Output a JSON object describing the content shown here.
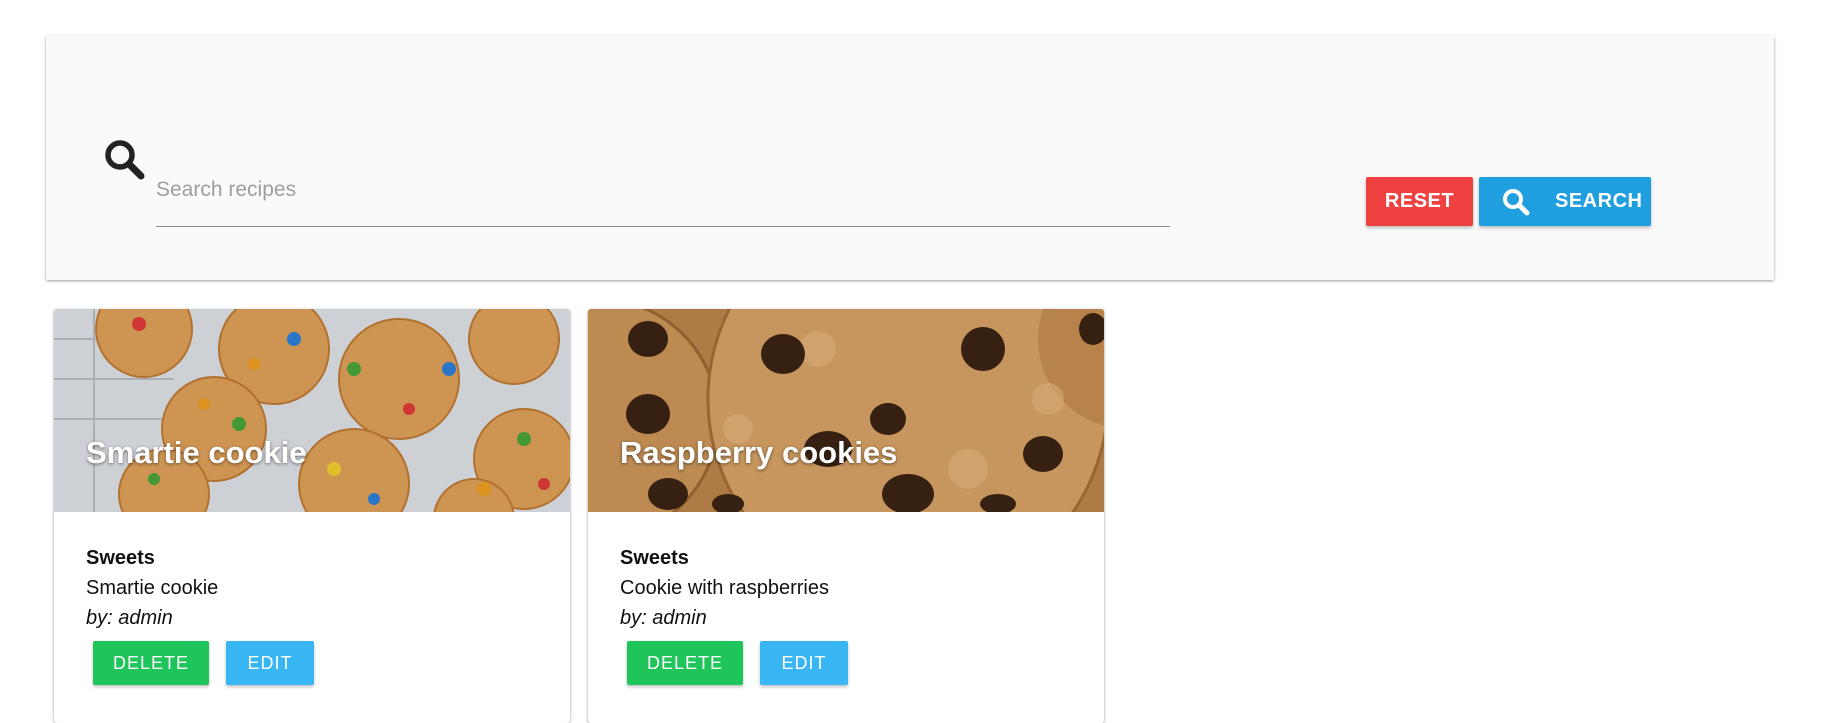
{
  "search": {
    "placeholder": "Search recipes",
    "value": "",
    "icon": "search-icon",
    "reset_label": "RESET",
    "search_label": "SEARCH"
  },
  "colors": {
    "reset": "#f04141",
    "search": "#1f9ee0",
    "delete": "#1fc45a",
    "edit": "#38b6f4"
  },
  "recipes": [
    {
      "title": "Smartie cookie",
      "category": "Sweets",
      "description": "Smartie cookie",
      "author": "by: admin",
      "delete_label": "DELETE",
      "edit_label": "EDIT"
    },
    {
      "title": "Raspberry cookies",
      "category": "Sweets",
      "description": "Cookie with raspberries",
      "author": "by: admin",
      "delete_label": "DELETE",
      "edit_label": "EDIT"
    }
  ]
}
